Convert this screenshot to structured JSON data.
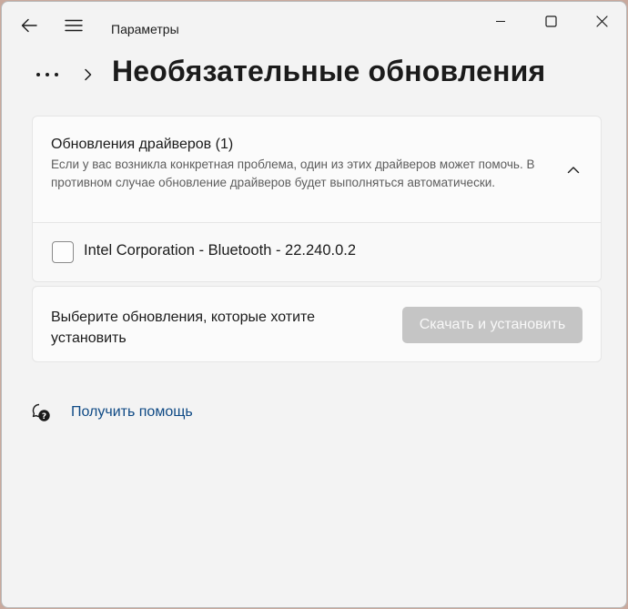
{
  "titlebar": {
    "app_title": "Параметры",
    "back_icon": "back-arrow-icon",
    "menu_icon": "hamburger-icon",
    "controls": [
      "minimize-icon",
      "maximize-icon",
      "close-icon"
    ]
  },
  "breadcrumb": {
    "more_icon": "more-dots-icon",
    "separator_icon": "chevron-right-icon",
    "title": "Необязательные обновления"
  },
  "driver_updates": {
    "title": "Обновления драйверов (1)",
    "description": "Если у вас возникла конкретная проблема, один из этих драйверов может помочь. В противном случае обновление драйверов будет выполняться автоматически.",
    "expanded": true,
    "chevron_icon": "chevron-up-icon",
    "items": [
      {
        "label": "Intel Corporation - Bluetooth - 22.240.0.2",
        "checked": false
      }
    ]
  },
  "action": {
    "prompt": "Выберите обновления, которые хотите установить",
    "install_label": "Скачать и установить",
    "install_enabled": false
  },
  "help": {
    "icon": "help-chat-icon",
    "label": "Получить помощь"
  },
  "colors": {
    "window_bg": "#f3f3f3",
    "card_bg": "#fbfbfb",
    "link": "#0f4a85",
    "disabled_button": "#c5c5c5"
  }
}
